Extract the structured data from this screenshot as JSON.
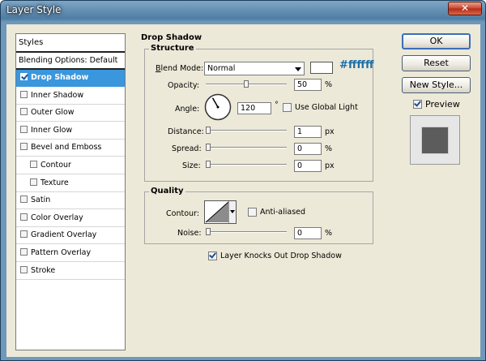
{
  "window": {
    "title": "Layer Style",
    "close_glyph": "✕"
  },
  "styles_list": {
    "header": "Styles",
    "blending_options": "Blending Options: Default",
    "items": [
      {
        "label": "Drop Shadow",
        "checked": true,
        "selected": true,
        "indent": false
      },
      {
        "label": "Inner Shadow",
        "checked": false,
        "indent": false
      },
      {
        "label": "Outer Glow",
        "checked": false,
        "indent": false
      },
      {
        "label": "Inner Glow",
        "checked": false,
        "indent": false
      },
      {
        "label": "Bevel and Emboss",
        "checked": false,
        "indent": false
      },
      {
        "label": "Contour",
        "checked": false,
        "indent": true
      },
      {
        "label": "Texture",
        "checked": false,
        "indent": true
      },
      {
        "label": "Satin",
        "checked": false,
        "indent": false
      },
      {
        "label": "Color Overlay",
        "checked": false,
        "indent": false
      },
      {
        "label": "Gradient Overlay",
        "checked": false,
        "indent": false
      },
      {
        "label": "Pattern Overlay",
        "checked": false,
        "indent": false
      },
      {
        "label": "Stroke",
        "checked": false,
        "indent": false
      }
    ]
  },
  "drop_shadow": {
    "section_title": "Drop Shadow",
    "structure": {
      "title": "Structure",
      "blend_mode_label": "Blend Mode:",
      "blend_mode_value": "Normal",
      "color_hex": "#ffffff",
      "swatch_color": "#ffffff",
      "opacity_label": "Opacity:",
      "opacity_value": "50",
      "opacity_unit": "%",
      "opacity_level": 50,
      "angle_label": "Angle:",
      "angle_value": "120",
      "angle_unit": "°",
      "angle_degrees": 120,
      "use_global_light_label": "Use Global Light",
      "use_global_light": false,
      "distance_label": "Distance:",
      "distance_value": "1",
      "distance_unit": "px",
      "distance_level": 0.5,
      "spread_label": "Spread:",
      "spread_value": "0",
      "spread_unit": "%",
      "spread_level": 0,
      "size_label": "Size:",
      "size_value": "0",
      "size_unit": "px",
      "size_level": 0
    },
    "quality": {
      "title": "Quality",
      "contour_label": "Contour:",
      "anti_aliased_label": "Anti-aliased",
      "anti_aliased": false,
      "noise_label": "Noise:",
      "noise_value": "0",
      "noise_unit": "%",
      "noise_level": 0
    },
    "knocks_out_label": "Layer Knocks Out Drop Shadow",
    "knocks_out": true
  },
  "buttons": {
    "ok": "OK",
    "reset": "Reset",
    "new_style": "New Style..."
  },
  "preview": {
    "label": "Preview",
    "checked": true,
    "swatch_color": "#5c5c5c"
  },
  "colors": {
    "accent": "#3a96dd",
    "hex_text": "#1a6ea8"
  }
}
